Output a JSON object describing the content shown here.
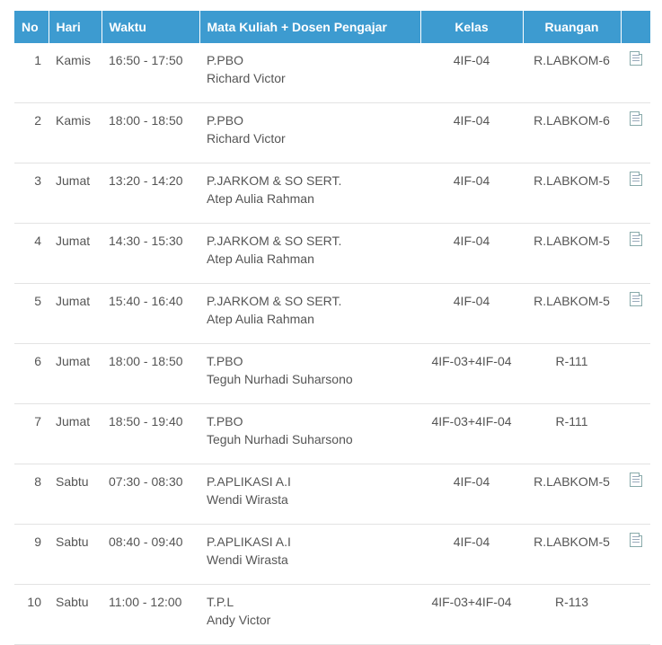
{
  "headers": {
    "no": "No",
    "hari": "Hari",
    "waktu": "Waktu",
    "mk": "Mata Kuliah + Dosen Pengajar",
    "kelas": "Kelas",
    "ruangan": "Ruangan"
  },
  "rows": [
    {
      "no": "1",
      "hari": "Kamis",
      "waktu": "16:50 - 17:50",
      "mk": "P.PBO",
      "dosen": "Richard Victor",
      "kelas": "4IF-04",
      "ruangan": "R.LABKOM-6",
      "icon": "document-icon"
    },
    {
      "no": "2",
      "hari": "Kamis",
      "waktu": "18:00 - 18:50",
      "mk": "P.PBO",
      "dosen": "Richard Victor",
      "kelas": "4IF-04",
      "ruangan": "R.LABKOM-6",
      "icon": "document-icon"
    },
    {
      "no": "3",
      "hari": "Jumat",
      "waktu": "13:20 - 14:20",
      "mk": "P.JARKOM & SO SERT.",
      "dosen": "Atep Aulia Rahman",
      "kelas": "4IF-04",
      "ruangan": "R.LABKOM-5",
      "icon": "document-icon"
    },
    {
      "no": "4",
      "hari": "Jumat",
      "waktu": "14:30 - 15:30",
      "mk": "P.JARKOM & SO SERT.",
      "dosen": "Atep Aulia Rahman",
      "kelas": "4IF-04",
      "ruangan": "R.LABKOM-5",
      "icon": "document-icon"
    },
    {
      "no": "5",
      "hari": "Jumat",
      "waktu": "15:40 - 16:40",
      "mk": "P.JARKOM & SO SERT.",
      "dosen": "Atep Aulia Rahman",
      "kelas": "4IF-04",
      "ruangan": "R.LABKOM-5",
      "icon": "document-icon"
    },
    {
      "no": "6",
      "hari": "Jumat",
      "waktu": "18:00 - 18:50",
      "mk": "T.PBO",
      "dosen": "Teguh Nurhadi Suharsono",
      "kelas": "4IF-03+4IF-04",
      "ruangan": "R-111",
      "icon": ""
    },
    {
      "no": "7",
      "hari": "Jumat",
      "waktu": "18:50 - 19:40",
      "mk": "T.PBO",
      "dosen": "Teguh Nurhadi Suharsono",
      "kelas": "4IF-03+4IF-04",
      "ruangan": "R-111",
      "icon": ""
    },
    {
      "no": "8",
      "hari": "Sabtu",
      "waktu": "07:30 - 08:30",
      "mk": "P.APLIKASI A.I",
      "dosen": "Wendi Wirasta",
      "kelas": "4IF-04",
      "ruangan": "R.LABKOM-5",
      "icon": "document-icon"
    },
    {
      "no": "9",
      "hari": "Sabtu",
      "waktu": "08:40 - 09:40",
      "mk": "P.APLIKASI A.I",
      "dosen": "Wendi Wirasta",
      "kelas": "4IF-04",
      "ruangan": "R.LABKOM-5",
      "icon": "document-icon"
    },
    {
      "no": "10",
      "hari": "Sabtu",
      "waktu": "11:00 - 12:00",
      "mk": "T.P.L",
      "dosen": "Andy Victor",
      "kelas": "4IF-03+4IF-04",
      "ruangan": "R-113",
      "icon": ""
    }
  ],
  "colors": {
    "header_bg": "#3d9bd0",
    "header_text": "#ffffff",
    "row_divider": "#e3e3e3"
  }
}
